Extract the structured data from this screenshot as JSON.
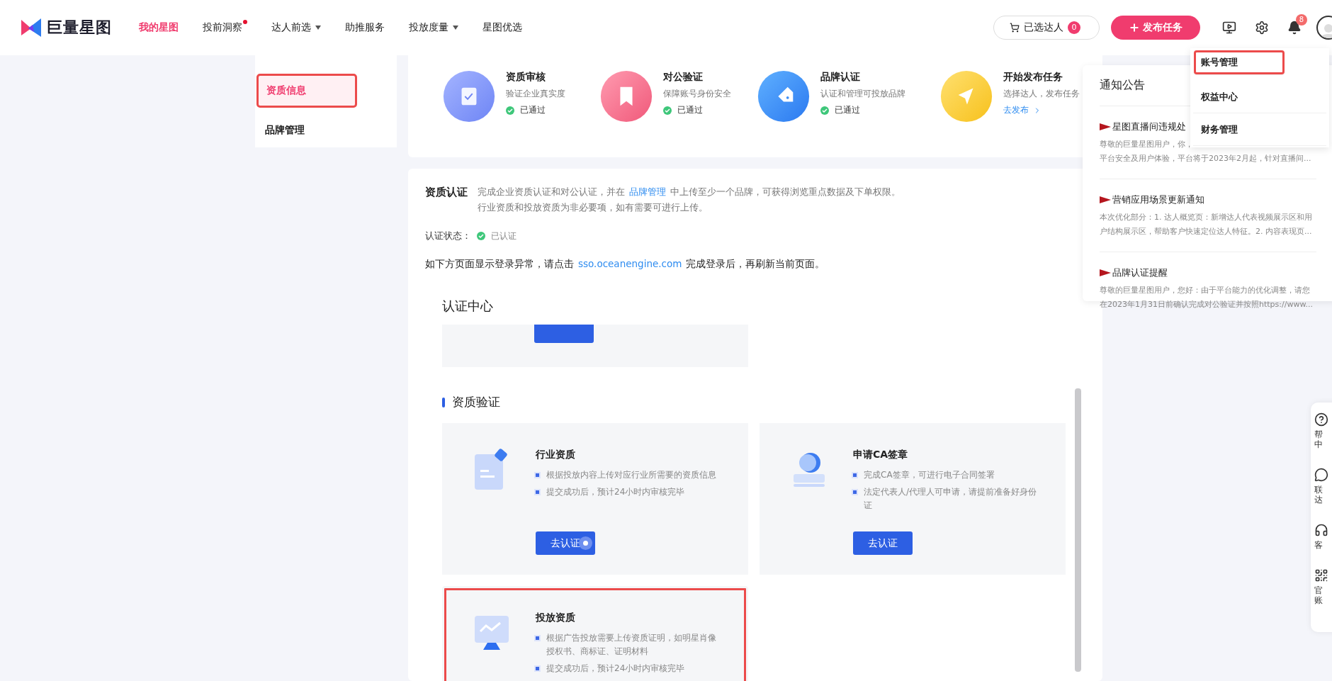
{
  "nav": {
    "logo": "巨量星图",
    "items": [
      {
        "label": "我的星图",
        "selected": true,
        "dot": false,
        "dropdown": false
      },
      {
        "label": "投前洞察",
        "selected": false,
        "dot": true,
        "dropdown": false
      },
      {
        "label": "达人前选",
        "selected": false,
        "dot": false,
        "dropdown": true
      },
      {
        "label": "助推服务",
        "selected": false,
        "dot": false,
        "dropdown": false
      },
      {
        "label": "投放度量",
        "selected": false,
        "dot": false,
        "dropdown": true
      },
      {
        "label": "星图优选",
        "selected": false,
        "dot": false,
        "dropdown": false
      }
    ],
    "cart": {
      "label": "已选达人",
      "count": "0"
    },
    "publish": {
      "label": "发布任务"
    },
    "notifications": {
      "count": "8"
    }
  },
  "sidebar": {
    "items": [
      {
        "label": "资质信息",
        "selected": true,
        "annotated": true
      },
      {
        "label": "品牌管理",
        "selected": false,
        "annotated": false
      }
    ]
  },
  "steps": [
    {
      "title": "资质审核",
      "desc": "验证企业真实度",
      "kind": "status",
      "status": "已通过"
    },
    {
      "title": "对公验证",
      "desc": "保障账号身份安全",
      "kind": "status",
      "status": "已通过"
    },
    {
      "title": "品牌认证",
      "desc": "认证和管理可投放品牌",
      "kind": "status",
      "status": "已通过"
    },
    {
      "title": "开始发布任务",
      "desc": "选择达人，发布任务",
      "kind": "link",
      "link": "去发布"
    }
  ],
  "certification": {
    "title": "资质认证",
    "desc_before": "完成企业资质认证和对公认证，并在",
    "desc_link": "品牌管理",
    "desc_after": "中上传至少一个品牌，可获得浏览重点数据及下单权限。",
    "desc_line2": "行业资质和投放资质为非必要项，如有需要可进行上传。",
    "status_label": "认证状态：",
    "status": "已认证",
    "notice_before": "如下方页面显示登录异常，请点击",
    "notice_link": "sso.oceanengine.com",
    "notice_after": "完成登录后，再刷新当前页面。"
  },
  "center": {
    "title": "认证中心"
  },
  "verification": {
    "title": "资质验证",
    "cards": [
      {
        "title": "行业资质",
        "bullets": [
          "根据投放内容上传对应行业所需要的资质信息",
          "提交成功后，预计24小时内审核完毕"
        ],
        "button": "去认证",
        "cursor": true,
        "annotated": false
      },
      {
        "title": "申请CA签章",
        "bullets": [
          "完成CA签章，可进行电子合同签署",
          "法定代表人/代理人可申请，请提前准备好身份证"
        ],
        "button": "去认证",
        "cursor": false,
        "annotated": false
      },
      {
        "title": "投放资质",
        "bullets": [
          "根据广告投放需要上传资质证明，如明星肖像授权书、商标证、证明材料",
          "提交成功后，预计24小时内审核完毕"
        ],
        "annotated": true
      }
    ]
  },
  "notices": {
    "title": "通知公告",
    "items": [
      {
        "title": "星图直播间违规处",
        "lines": [
          "尊敬的巨量星图用户，你，",
          "平台安全及用户体验，平台将于2023年2月起，针对直播间..."
        ]
      },
      {
        "title": "营销应用场景更新通知",
        "lines": [
          "本次优化部分：1. 达人概览页：新增达人代表视频展示区和用",
          "户结构展示区，帮助客户快速定位达人特征。2. 内容表现页..."
        ]
      },
      {
        "title": "品牌认证提醒",
        "lines": [
          "尊敬的巨量星图用户，您好：由于平台能力的优化调整，请您",
          "在2023年1月31日前确认完成对公验证并按照https://www..."
        ]
      }
    ]
  },
  "account_menu": {
    "items": [
      {
        "label": "账号管理",
        "annotated": true
      },
      {
        "label": "权益中心",
        "annotated": false
      },
      {
        "label": "财务管理",
        "annotated": false
      }
    ]
  },
  "help_bar": {
    "items": [
      {
        "lines": [
          "帮",
          "中"
        ]
      },
      {
        "lines": [
          "联",
          "达"
        ]
      },
      {
        "lines": [
          "客"
        ]
      },
      {
        "lines": [
          "官",
          "账"
        ]
      }
    ]
  }
}
